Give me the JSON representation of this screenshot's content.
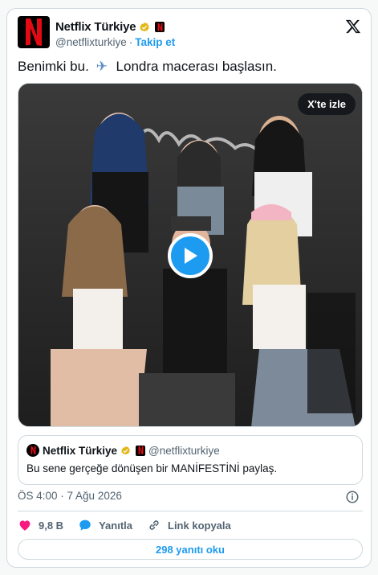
{
  "header": {
    "display_name": "Netflix Türkiye",
    "handle": "@netflixturkiye",
    "separator": "·",
    "follow_label": "Takip et"
  },
  "tweet": {
    "text_before": "Benimki bu.",
    "text_after": "Londra macerası başlasın.",
    "emoji_icon": "airplane-icon"
  },
  "media": {
    "watch_label": "X'te izle"
  },
  "quoted": {
    "display_name": "Netflix Türkiye",
    "handle": "@netflixturkiye",
    "text": "Bu sene gerçeğe dönüşen bir MANİFESTİNİ paylaş."
  },
  "timestamp": "ÖS 4:00 · 7 Ağu 2026",
  "actions": {
    "like_count": "9,8 B",
    "reply_label": "Yanıtla",
    "copy_link_label": "Link kopyala"
  },
  "read_replies_label": "298 yanıtı oku",
  "colors": {
    "accent": "#1d9bf0",
    "like": "#f91880",
    "netflix_red": "#e50914",
    "verified_gold": "#e2b719"
  }
}
